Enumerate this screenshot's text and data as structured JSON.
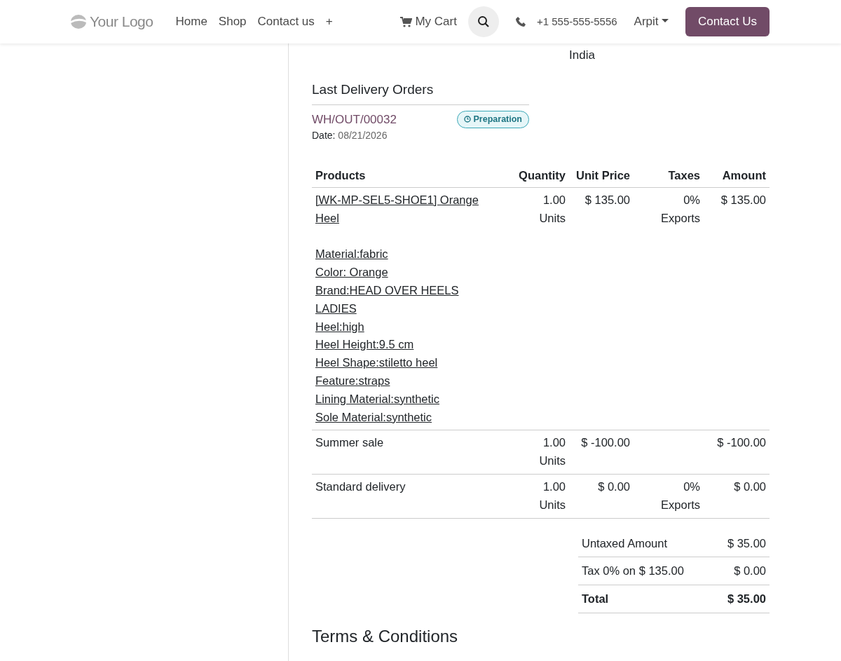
{
  "navbar": {
    "logo": "Your Logo",
    "menu": [
      {
        "label": "Home"
      },
      {
        "label": "Shop"
      },
      {
        "label": "Contact us"
      },
      {
        "label": "+"
      }
    ],
    "cart": "My Cart",
    "phone": "+1 555-555-5556",
    "user": "Arpit",
    "cta": "Contact Us"
  },
  "address_tail": "India",
  "delivery": {
    "title": "Last Delivery Orders",
    "orders": [
      {
        "reference": "WH/OUT/00032",
        "status": "Preparation",
        "date_label": "Date:",
        "date": "08/21/2026"
      }
    ]
  },
  "table": {
    "columns": [
      {
        "label": "Products"
      },
      {
        "label": "Quantity"
      },
      {
        "label": "Unit Price"
      },
      {
        "label": "Taxes"
      },
      {
        "label": "Amount"
      }
    ],
    "rows": [
      {
        "kind": "link",
        "product": "[WK-MP-SEL5-SHOE1] Orange Heel",
        "details": [
          "Material:fabric",
          "Color: Orange",
          "Brand:HEAD OVER HEELS LADIES",
          "Heel:high",
          "Heel Height:9.5 cm",
          "Heel Shape:stiletto heel",
          "Feature:straps",
          "Lining Material:synthetic",
          "Sole Material:synthetic"
        ],
        "quantity": "1.00",
        "unit": "Units",
        "unit_price": "$ 135.00",
        "taxes": "0%",
        "tax_name": "Exports",
        "amount": "$ 135.00"
      },
      {
        "kind": "text",
        "product": "Summer sale",
        "quantity": "1.00",
        "unit": "Units",
        "unit_price": "$ -100.00",
        "amount": "$ -100.00"
      },
      {
        "kind": "text",
        "product": "Standard delivery",
        "quantity": "1.00",
        "unit": "Units",
        "unit_price": "$ 0.00",
        "taxes": "0%",
        "tax_name": "Exports",
        "amount": "$ 0.00"
      }
    ]
  },
  "totals": [
    {
      "label": "Untaxed Amount",
      "value": "$ 35.00",
      "bold": false
    },
    {
      "label": "Tax 0% on $ 135.00",
      "value": "$ 0.00",
      "bold": false
    },
    {
      "label": "Total",
      "value": "$ 35.00",
      "bold": true
    }
  ],
  "terms_title": "Terms & Conditions"
}
